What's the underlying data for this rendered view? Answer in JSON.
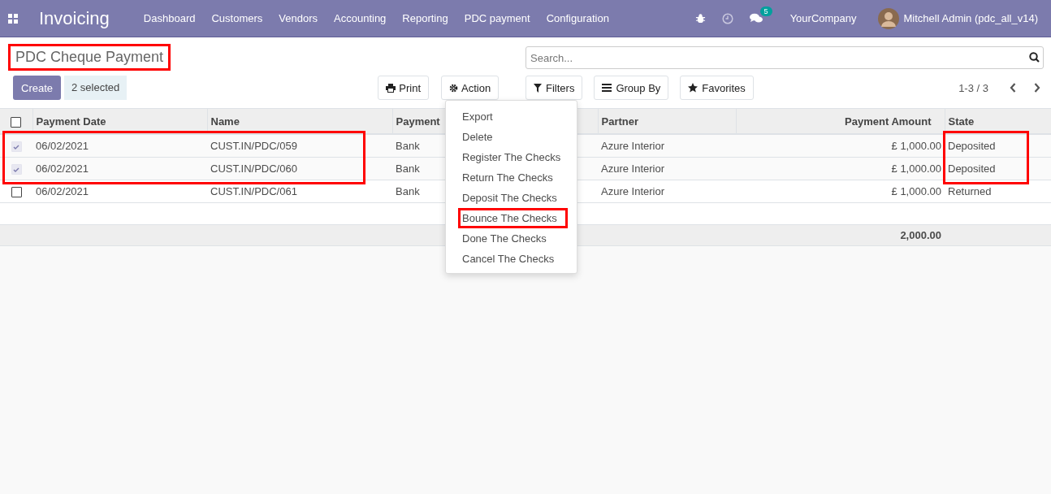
{
  "navbar": {
    "app_name": "Invoicing",
    "menu": [
      "Dashboard",
      "Customers",
      "Vendors",
      "Accounting",
      "Reporting",
      "PDC payment",
      "Configuration"
    ],
    "message_count": "5",
    "company": "YourCompany",
    "user": "Mitchell Admin (pdc_all_v14)"
  },
  "breadcrumb": {
    "title": "PDC Cheque Payment",
    "highlighted": true
  },
  "buttons": {
    "create": "Create",
    "selected_count": "2 selected",
    "print": "Print",
    "action": "Action"
  },
  "search": {
    "placeholder": "Search..."
  },
  "filters": [
    "Filters",
    "Group By",
    "Favorites"
  ],
  "pager": {
    "range": "1-3 / 3"
  },
  "action_menu": [
    {
      "label": "Export",
      "highlighted": false
    },
    {
      "label": "Delete",
      "highlighted": false
    },
    {
      "label": "Register The Checks",
      "highlighted": false
    },
    {
      "label": "Return The Checks",
      "highlighted": false
    },
    {
      "label": "Deposit The Checks",
      "highlighted": false
    },
    {
      "label": "Bounce The Checks",
      "highlighted": true
    },
    {
      "label": "Done The Checks",
      "highlighted": false
    },
    {
      "label": "Cancel The Checks",
      "highlighted": false
    }
  ],
  "table": {
    "select_all_checked": false,
    "columns": [
      "Payment Date",
      "Name",
      "Payment",
      "Partner",
      "Payment Amount",
      "State"
    ],
    "rows": [
      {
        "date": "06/02/2021",
        "name": "CUST.IN/PDC/059",
        "journal": "Bank",
        "partner": "Azure Interior",
        "amount": "£ 1,000.00",
        "state": "Deposited",
        "selected": true,
        "highlighted": true
      },
      {
        "date": "06/02/2021",
        "name": "CUST.IN/PDC/060",
        "journal": "Bank",
        "partner": "Azure Interior",
        "amount": "£ 1,000.00",
        "state": "Deposited",
        "selected": true,
        "highlighted": true
      },
      {
        "date": "06/02/2021",
        "name": "CUST.IN/PDC/061",
        "journal": "Bank",
        "partner": "Azure Interior",
        "amount": "£ 1,000.00",
        "state": "Returned",
        "selected": false,
        "highlighted": false
      }
    ],
    "total": "2,000.00"
  }
}
